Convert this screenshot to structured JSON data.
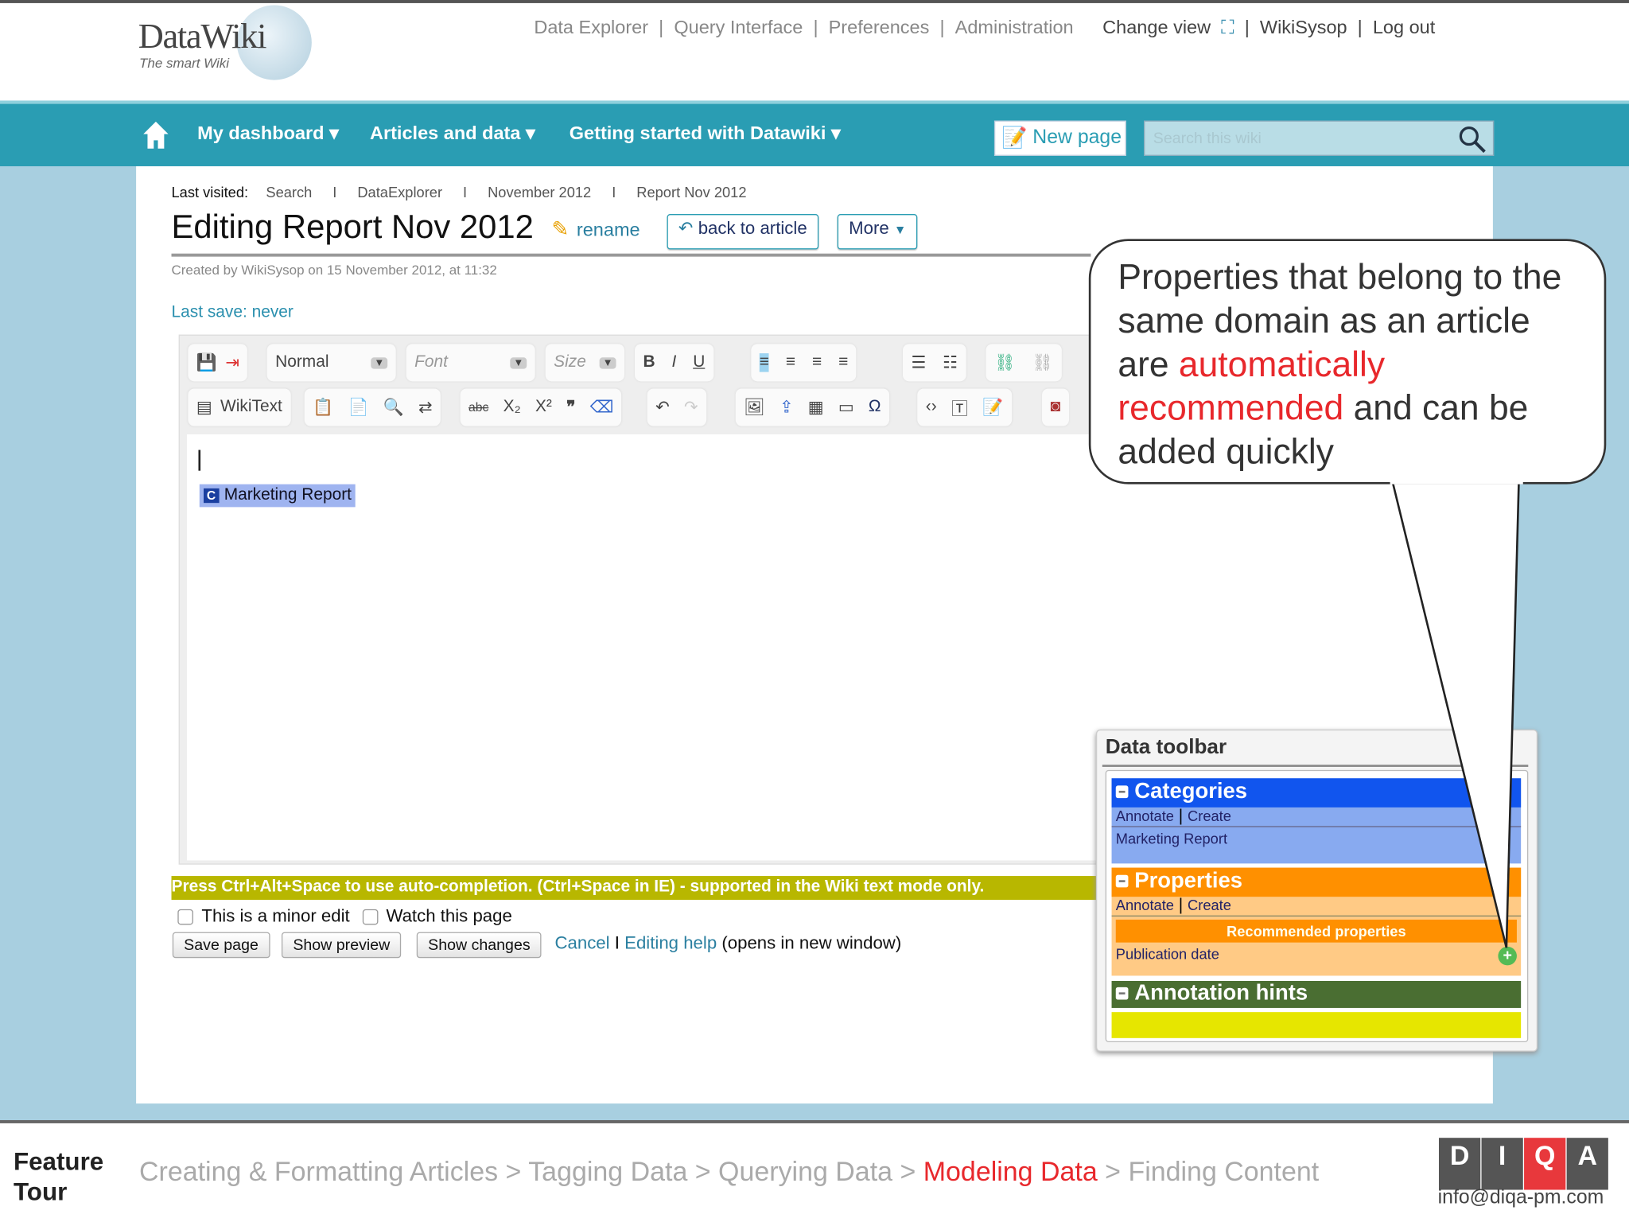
{
  "header": {
    "logo": "DataWiki",
    "tagline": "The smart Wiki",
    "links": [
      "Data Explorer",
      "Query Interface",
      "Preferences",
      "Administration"
    ],
    "change_view": "Change view",
    "user": "WikiSysop",
    "logout": "Log out"
  },
  "nav": {
    "items": [
      "My dashboard",
      "Articles and data",
      "Getting started with Datawiki"
    ],
    "new_page": "New page",
    "search_placeholder": "Search this wiki"
  },
  "breadcrumb": {
    "label": "Last visited:",
    "items": [
      "Search",
      "DataExplorer",
      "November 2012",
      "Report Nov 2012"
    ]
  },
  "page": {
    "title": "Editing Report Nov 2012",
    "rename": "rename",
    "back": "back to article",
    "more": "More",
    "created": "Created by WikiSysop on 15 November 2012, at 11:32",
    "last_save": "Last save: never"
  },
  "editor": {
    "format": "Normal",
    "font": "Font",
    "size": "Size",
    "wikitext": "WikiText",
    "category": "Marketing Report"
  },
  "hint": "Press Ctrl+Alt+Space to use auto-completion. (Ctrl+Space in IE) - supported in the Wiki text mode only.",
  "options": {
    "minor": "This is a minor edit",
    "watch": "Watch this page"
  },
  "buttons": {
    "save": "Save page",
    "preview": "Show preview",
    "changes": "Show changes",
    "cancel": "Cancel",
    "sep": "I",
    "help": "Editing help",
    "help_note": "(opens in new window)"
  },
  "callout": {
    "part1": "Properties that belong to the same domain as an article are ",
    "highlight": "automatically recommended",
    "part2": " and can be added quickly"
  },
  "data_toolbar": {
    "title": "Data toolbar",
    "categories": "Categories",
    "annotate": "Annotate",
    "create": "Create",
    "category_item": "Marketing Report",
    "properties": "Properties",
    "recommended": "Recommended properties",
    "property_item": "Publication date",
    "hints": "Annotation hints"
  },
  "footer": {
    "label1": "Feature",
    "label2": "Tour",
    "steps": [
      "Creating & Formatting Articles",
      "Tagging Data",
      "Querying Data",
      "Modeling Data",
      "Finding Content"
    ],
    "active_step": "Modeling Data",
    "email": "info@diqa-pm.com",
    "logo": [
      "D",
      "I",
      "Q",
      "A"
    ]
  },
  "colors": {
    "teal": "#2a9db3",
    "accent_red": "#e8282c",
    "categories": "#1155ee",
    "properties": "#ff9000",
    "hints": "#4a6e32"
  }
}
